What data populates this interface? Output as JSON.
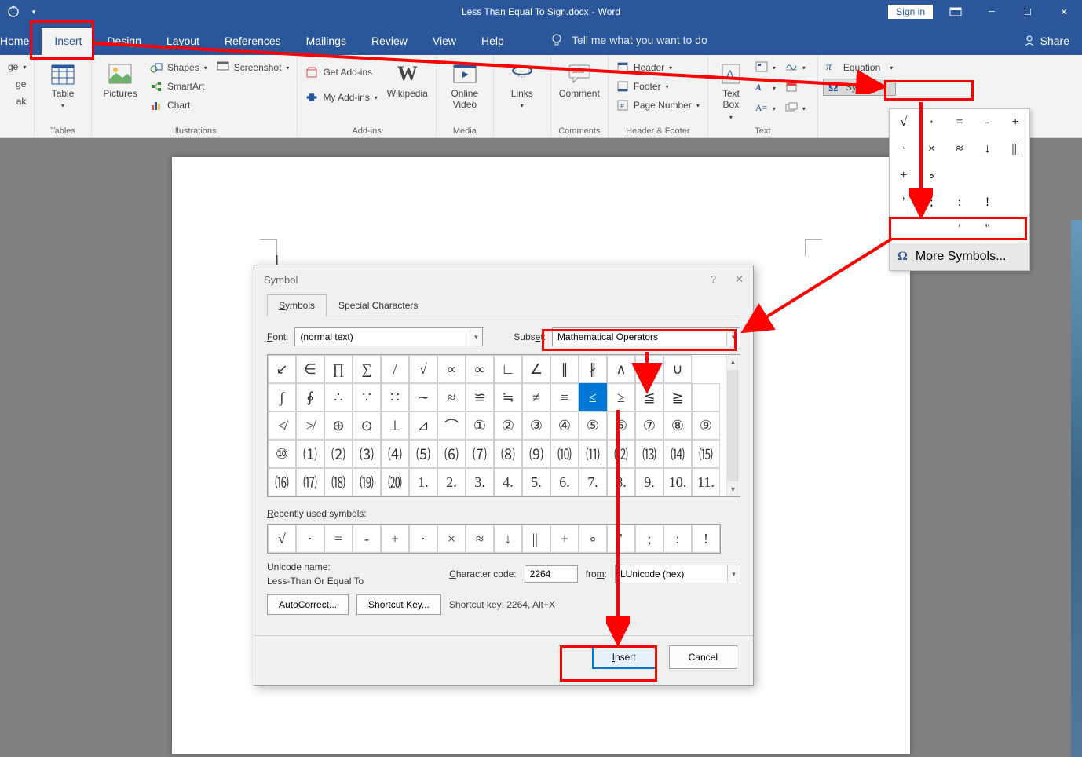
{
  "titlebar": {
    "docname": "Less Than Equal To Sign.docx",
    "appname": "Word",
    "signin": "Sign in"
  },
  "tabs": [
    "Home",
    "Insert",
    "Design",
    "Layout",
    "References",
    "Mailings",
    "Review",
    "View",
    "Help"
  ],
  "tellme": "Tell me what you want to do",
  "share": "Share",
  "ribbon": {
    "pages": {
      "coverpage": "ge",
      "breaklabel": "ak",
      "pages_label": ""
    },
    "table": "Table",
    "tables_label": "Tables",
    "pictures": "Pictures",
    "shapes": "Shapes",
    "smartart": "SmartArt",
    "chart": "Chart",
    "screenshot": "Screenshot",
    "illustrations_label": "Illustrations",
    "getaddins": "Get Add-ins",
    "myaddins": "My Add-ins",
    "wikipedia": "Wikipedia",
    "addins_label": "Add-ins",
    "onlinevideo": "Online Video",
    "media_label": "Media",
    "links": "Links",
    "comment": "Comment",
    "comments_label": "Comments",
    "header": "Header",
    "footer": "Footer",
    "pagenumber": "Page Number",
    "hf_label": "Header & Footer",
    "textbox": "Text Box",
    "text_label": "Text",
    "equation": "Equation",
    "symbol": "Symbol"
  },
  "symbol_panel": {
    "grid": [
      "√",
      "·",
      "=",
      "-",
      "+",
      "·",
      "×",
      "≈",
      "↓",
      "|||",
      "+",
      "∘",
      "",
      "",
      "",
      "'",
      ";",
      ":",
      "!",
      "",
      "",
      "",
      "'",
      "\"",
      ""
    ],
    "more": "More Symbols..."
  },
  "dialog": {
    "title": "Symbol",
    "tab_symbols": "Symbols",
    "tab_special": "Special Characters",
    "font_label": "Font:",
    "font_value": "(normal text)",
    "subset_label": "Subset:",
    "subset_value": "Mathematical Operators",
    "rows": [
      [
        "↙",
        "∈",
        "∏",
        "∑",
        "/",
        "√",
        "∝",
        "∞",
        "∟",
        "∠",
        "∥",
        "∦",
        "∧",
        "∩",
        "∪"
      ],
      [
        "∫",
        "∮",
        "∴",
        "∵",
        "∷",
        "∼",
        "≈",
        "≌",
        "≒",
        "≠",
        "≡",
        "≤",
        "≥",
        "≦",
        "≧"
      ],
      [
        "≮",
        "≯",
        "⊕",
        "⊙",
        "⊥",
        "⊿",
        "⌒",
        "①",
        "②",
        "③",
        "④",
        "⑤",
        "⑥",
        "⑦",
        "⑧",
        "⑨"
      ],
      [
        "⑩",
        "⑴",
        "⑵",
        "⑶",
        "⑷",
        "⑸",
        "⑹",
        "⑺",
        "⑻",
        "⑼",
        "⑽",
        "⑾",
        "⑿",
        "⒀",
        "⒁",
        "⒂"
      ],
      [
        "⒃",
        "⒄",
        "⒅",
        "⒆",
        "⒇",
        "1.",
        "2.",
        "3.",
        "4.",
        "5.",
        "6.",
        "7.",
        "8.",
        "9.",
        "10.",
        "11."
      ]
    ],
    "selected_index": {
      "r": 1,
      "c": 11
    },
    "recent_label": "Recently used symbols:",
    "recent": [
      "√",
      "·",
      "=",
      "-",
      "+",
      "·",
      "×",
      "≈",
      "↓",
      "|||",
      "+",
      "∘",
      "'",
      ";",
      ":",
      "!"
    ],
    "unicode_name_label": "Unicode name:",
    "unicode_name": "Less-Than Or Equal To",
    "charcode_label": "Character code:",
    "charcode": "2264",
    "from_label": "from:",
    "from_value": "LUnicode (hex)",
    "autocorrect": "AutoCorrect...",
    "shortcutkey_btn": "Shortcut Key...",
    "shortcuttext": "Shortcut key: 2264, Alt+X",
    "insert": "Insert",
    "cancel": "Cancel"
  }
}
